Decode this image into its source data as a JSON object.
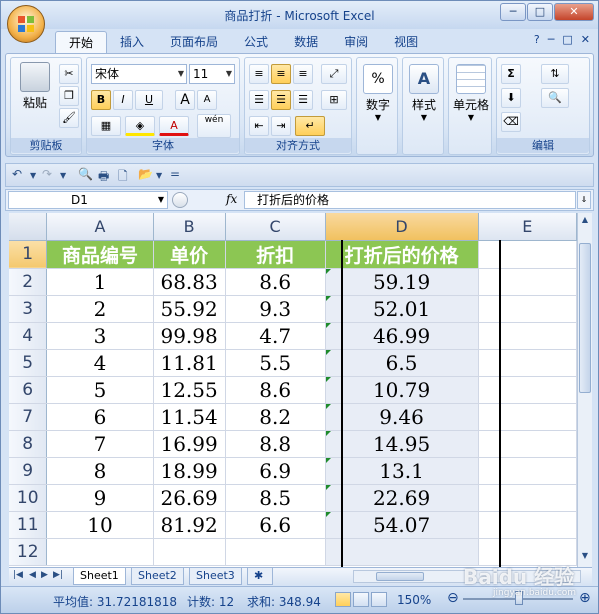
{
  "window": {
    "title": "商品打折 - Microsoft Excel"
  },
  "window_buttons": {
    "minimize": "─",
    "maximize": "□",
    "close": "✕"
  },
  "tabs": [
    "开始",
    "插入",
    "页面布局",
    "公式",
    "数据",
    "审阅",
    "视图"
  ],
  "tab_right": {
    "help": "?",
    "minimize": "─",
    "restore": "□",
    "close": "✕"
  },
  "ribbon": {
    "clipboard": {
      "paste": "粘贴",
      "label": "剪贴板"
    },
    "font": {
      "name": "宋体",
      "size": "11",
      "label": "字体",
      "bold": "B",
      "italic": "I",
      "underline": "U",
      "grow": "A",
      "shrink": "A",
      "font_color": "A",
      "phonetic": "wén"
    },
    "alignment": {
      "label": "对齐方式"
    },
    "number": {
      "button": "数字",
      "icon": "%"
    },
    "styles": {
      "button": "样式"
    },
    "cells": {
      "button": "单元格"
    },
    "editing": {
      "label": "编辑",
      "sum": "Σ"
    }
  },
  "formula_bar": {
    "name_box": "D1",
    "fx": "fx",
    "content": "打折后的价格"
  },
  "columns": [
    "A",
    "B",
    "C",
    "D",
    "E"
  ],
  "rows": [
    "1",
    "2",
    "3",
    "4",
    "5",
    "6",
    "7",
    "8",
    "9",
    "10",
    "11",
    "12"
  ],
  "table": {
    "header": [
      "商品编号",
      "单价",
      "折扣",
      "打折后的价格"
    ],
    "data": [
      [
        "1",
        "68.83",
        "8.6",
        "59.19"
      ],
      [
        "2",
        "55.92",
        "9.3",
        "52.01"
      ],
      [
        "3",
        "99.98",
        "4.7",
        "46.99"
      ],
      [
        "4",
        "11.81",
        "5.5",
        "6.5"
      ],
      [
        "5",
        "12.55",
        "8.6",
        "10.79"
      ],
      [
        "6",
        "11.54",
        "8.2",
        "9.46"
      ],
      [
        "7",
        "16.99",
        "8.8",
        "14.95"
      ],
      [
        "8",
        "18.99",
        "6.9",
        "13.1"
      ],
      [
        "9",
        "26.69",
        "8.5",
        "22.69"
      ],
      [
        "10",
        "81.92",
        "6.6",
        "54.07"
      ]
    ]
  },
  "sheet_tabs": [
    "Sheet1",
    "Sheet2",
    "Sheet3"
  ],
  "status": {
    "average": "平均值: 31.72181818",
    "count": "计数: 12",
    "sum": "求和: 348.94",
    "zoom": "150%"
  },
  "watermark": {
    "main": "Baidu 经验",
    "sub": "jingyan.baidu.com"
  },
  "colors": {
    "header_fill": "#8cc653",
    "selection": "#e8edf6",
    "accent": "#15428b"
  }
}
